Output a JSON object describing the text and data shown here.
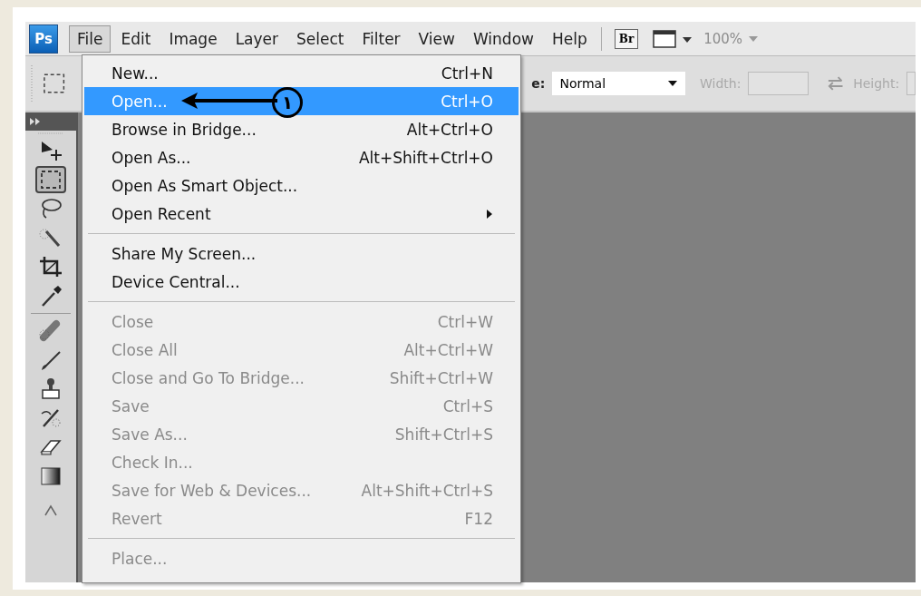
{
  "menubar": {
    "logo": "Ps",
    "items": [
      {
        "label": "File",
        "selected": true
      },
      {
        "label": "Edit",
        "selected": false
      },
      {
        "label": "Image",
        "selected": false
      },
      {
        "label": "Layer",
        "selected": false
      },
      {
        "label": "Select",
        "selected": false
      },
      {
        "label": "Filter",
        "selected": false
      },
      {
        "label": "View",
        "selected": false
      },
      {
        "label": "Window",
        "selected": false
      },
      {
        "label": "Help",
        "selected": false
      }
    ],
    "bridge_button": "Br",
    "zoom": {
      "value": "100%",
      "disabled": true
    }
  },
  "options_bar": {
    "style_label": "e:",
    "style_value": "Normal",
    "width_label": "Width:",
    "height_label": "Height:"
  },
  "toolbox": {
    "tools": [
      {
        "kind": "move",
        "selected": false
      },
      {
        "kind": "marquee",
        "selected": true
      },
      {
        "kind": "lasso",
        "selected": false
      },
      {
        "kind": "wand",
        "selected": false
      },
      {
        "kind": "crop",
        "selected": false
      },
      {
        "kind": "eyedropper",
        "selected": false
      },
      {
        "kind": "divider"
      },
      {
        "kind": "bandage",
        "selected": false
      },
      {
        "kind": "brush",
        "selected": false
      },
      {
        "kind": "stamp",
        "selected": false
      },
      {
        "kind": "history",
        "selected": false
      },
      {
        "kind": "eraser",
        "selected": false
      },
      {
        "kind": "gradient",
        "selected": false
      },
      {
        "kind": "partial",
        "selected": false
      }
    ]
  },
  "file_menu": {
    "items": [
      {
        "kind": "item",
        "label": "New...",
        "shortcut": "Ctrl+N",
        "disabled": false,
        "selected": false
      },
      {
        "kind": "item",
        "label": "Open...",
        "shortcut": "Ctrl+O",
        "disabled": false,
        "selected": true
      },
      {
        "kind": "item",
        "label": "Browse in Bridge...",
        "shortcut": "Alt+Ctrl+O",
        "disabled": false,
        "selected": false
      },
      {
        "kind": "item",
        "label": "Open As...",
        "shortcut": "Alt+Shift+Ctrl+O",
        "disabled": false,
        "selected": false
      },
      {
        "kind": "item",
        "label": "Open As Smart Object...",
        "disabled": false,
        "selected": false
      },
      {
        "kind": "submenu",
        "label": "Open Recent",
        "disabled": false,
        "selected": false
      },
      {
        "kind": "separator"
      },
      {
        "kind": "item",
        "label": "Share My Screen...",
        "disabled": false,
        "selected": false
      },
      {
        "kind": "item",
        "label": "Device Central...",
        "disabled": false,
        "selected": false
      },
      {
        "kind": "separator"
      },
      {
        "kind": "item",
        "label": "Close",
        "shortcut": "Ctrl+W",
        "disabled": true,
        "selected": false
      },
      {
        "kind": "item",
        "label": "Close All",
        "shortcut": "Alt+Ctrl+W",
        "disabled": true,
        "selected": false
      },
      {
        "kind": "item",
        "label": "Close and Go To Bridge...",
        "shortcut": "Shift+Ctrl+W",
        "disabled": true,
        "selected": false
      },
      {
        "kind": "item",
        "label": "Save",
        "shortcut": "Ctrl+S",
        "disabled": true,
        "selected": false
      },
      {
        "kind": "item",
        "label": "Save As...",
        "shortcut": "Shift+Ctrl+S",
        "disabled": true,
        "selected": false
      },
      {
        "kind": "item",
        "label": "Check In...",
        "disabled": true,
        "selected": false
      },
      {
        "kind": "item",
        "label": "Save for Web & Devices...",
        "shortcut": "Alt+Shift+Ctrl+S",
        "disabled": true,
        "selected": false
      },
      {
        "kind": "item",
        "label": "Revert",
        "shortcut": "F12",
        "disabled": true,
        "selected": false
      },
      {
        "kind": "separator"
      },
      {
        "kind": "item",
        "label": "Place...",
        "disabled": true,
        "selected": false
      }
    ]
  },
  "annotation": {
    "number": "١"
  }
}
